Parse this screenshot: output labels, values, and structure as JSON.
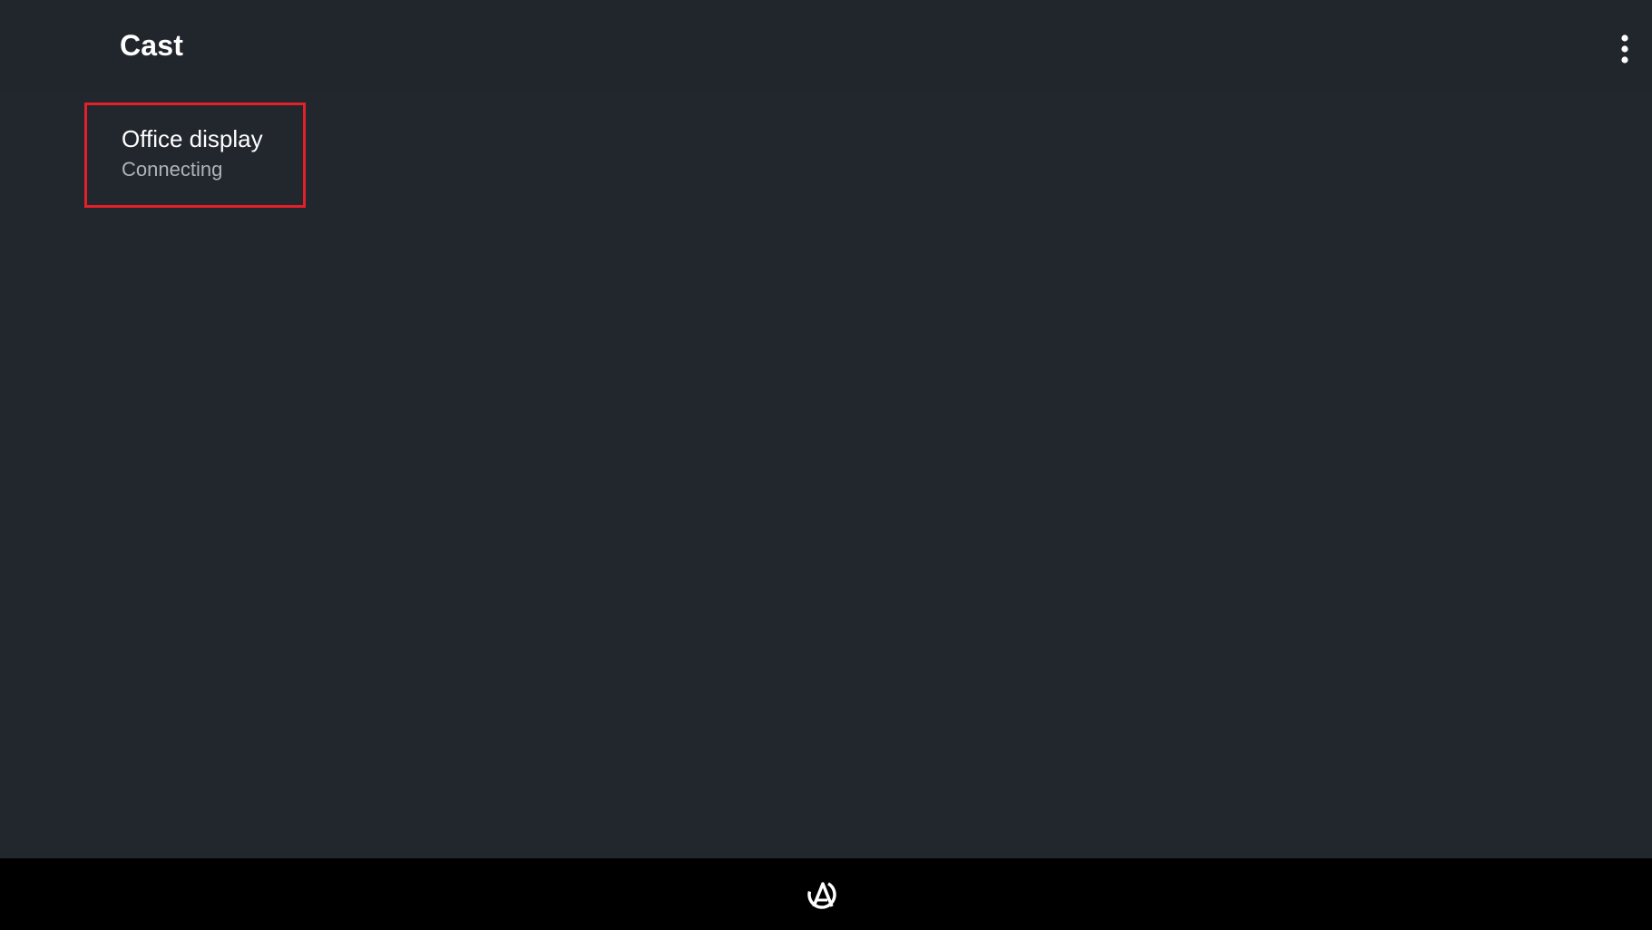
{
  "app_bar": {
    "title": "Cast",
    "overflow_icon": "more-vert-icon"
  },
  "routes": [
    {
      "name": "Office display",
      "status": "Connecting",
      "highlight_color": "#e3202a"
    }
  ],
  "nav_bar": {
    "home_icon": "launcher-logo-icon"
  },
  "colors": {
    "background": "#22262d",
    "title_text": "#ffffff",
    "secondary_text": "#aeb4bb",
    "nav_background": "#000000"
  }
}
